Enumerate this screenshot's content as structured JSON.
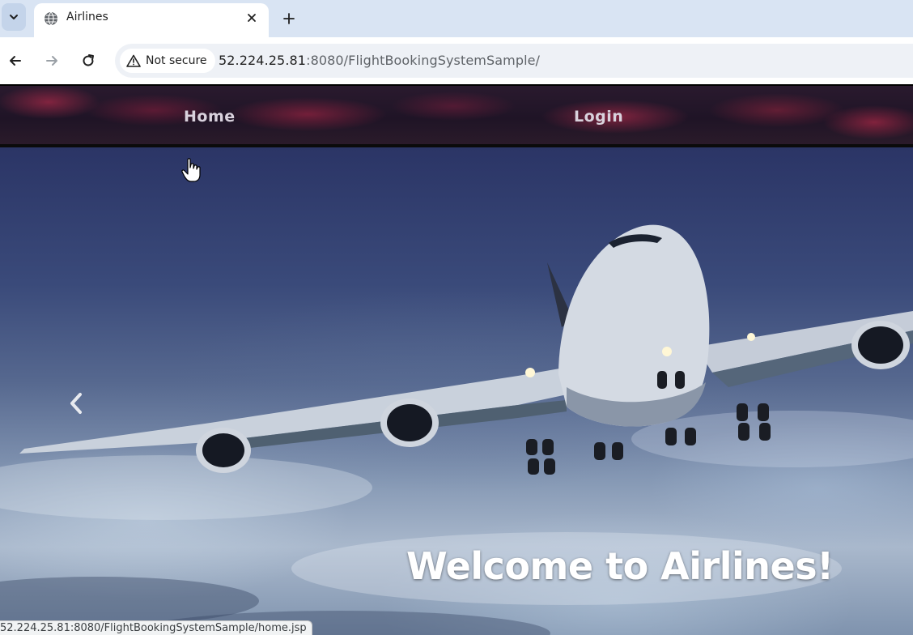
{
  "browser": {
    "tab": {
      "title": "Airlines",
      "favicon": "globe-icon"
    },
    "security_label": "Not secure",
    "url_host": "52.224.25.81",
    "url_rest": ":8080/FlightBookingSystemSample/",
    "status_url": "52.224.25.81:8080/FlightBookingSystemSample/home.jsp"
  },
  "navbar": {
    "items": [
      {
        "label": "Home"
      },
      {
        "label": "Login"
      }
    ]
  },
  "hero": {
    "heading": "Welcome to Airlines!",
    "prev_icon": "chevron-left-icon"
  },
  "colors": {
    "tabstrip": "#d9e4f3",
    "navbar": "#2a1a2e",
    "nav_text": "#d9d2dd",
    "heading": "#ffffff"
  }
}
